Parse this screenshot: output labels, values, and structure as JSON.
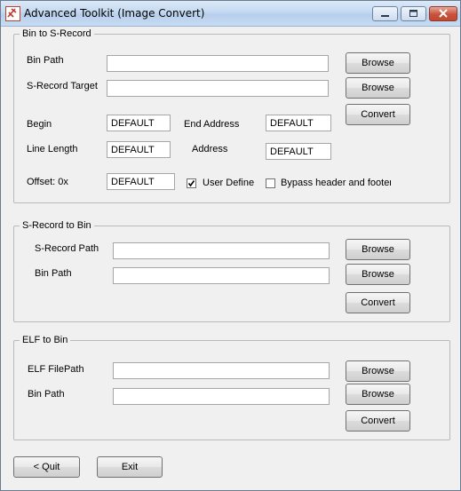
{
  "window": {
    "title": "Advanced Toolkit (Image Convert)"
  },
  "bin_to_srec": {
    "title": "Bin to S-Record",
    "bin_path_label": "Bin Path",
    "bin_path_value": "",
    "srec_target_label": "S-Record Target",
    "srec_target_value": "",
    "browse_label": "Browse",
    "browse2_label": "Browse",
    "convert_label": "Convert",
    "begin_label": "Begin",
    "begin_value": "DEFAULT",
    "end_address_label": "End Address",
    "end_address_value": "DEFAULT",
    "line_length_label": "Line Length",
    "line_length_value": "DEFAULT",
    "address_label": "Address",
    "address_value": "DEFAULT",
    "offset_label": "Offset: 0x",
    "offset_value": "DEFAULT",
    "user_define_label": "User Define",
    "user_define_checked": true,
    "bypass_label": "Bypass header and footer",
    "bypass_checked": false
  },
  "srec_to_bin": {
    "title": "S-Record to Bin",
    "srec_path_label": "S-Record Path",
    "srec_path_value": "",
    "bin_path_label": "Bin Path",
    "bin_path_value": "",
    "browse_label": "Browse",
    "browse2_label": "Browse",
    "convert_label": "Convert"
  },
  "elf_to_bin": {
    "title": "ELF to Bin",
    "elf_path_label": "ELF FilePath",
    "elf_path_value": "",
    "bin_path_label": "Bin Path",
    "bin_path_value": "",
    "browse_label": "Browse",
    "browse2_label": "Browse",
    "convert_label": "Convert"
  },
  "footer": {
    "quit_label": "< Quit",
    "exit_label": "Exit"
  }
}
